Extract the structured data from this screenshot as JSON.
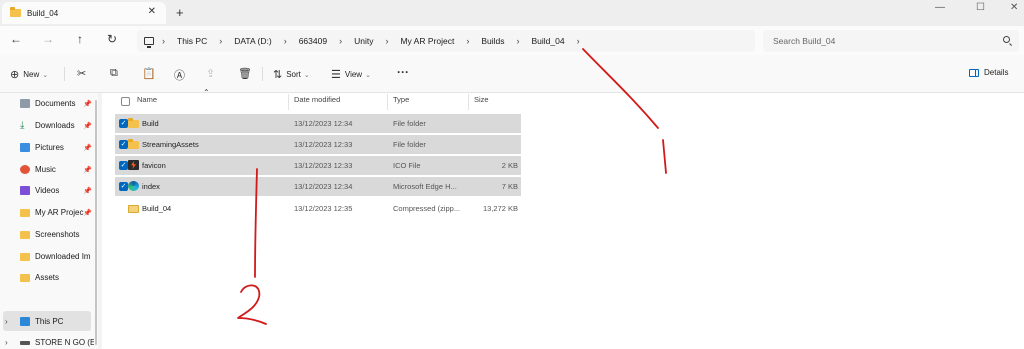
{
  "window": {
    "tab_title": "Build_04",
    "tab_close": "✕",
    "new_tab": "+",
    "controls": {
      "minimize": "—",
      "maximize": "☐",
      "close": "✕"
    }
  },
  "nav": {
    "back": "←",
    "forward": "→",
    "up": "↑",
    "refresh": "↻",
    "breadcrumbs": [
      "This PC",
      "DATA (D:)",
      "663409",
      "Unity",
      "My AR Project",
      "Builds",
      "Build_04"
    ],
    "breadcrumb_separator": "›",
    "search_placeholder": "Search Build_04"
  },
  "toolbar": {
    "new_label": "New",
    "sort_label": "Sort",
    "view_label": "View",
    "more_label": "···",
    "details_label": "Details"
  },
  "sidebar": {
    "items": [
      {
        "label": "Documents",
        "icon": "documents-icon",
        "pinned": true
      },
      {
        "label": "Downloads",
        "icon": "downloads-icon",
        "pinned": true
      },
      {
        "label": "Pictures",
        "icon": "pictures-icon",
        "pinned": true
      },
      {
        "label": "Music",
        "icon": "music-icon",
        "pinned": true
      },
      {
        "label": "Videos",
        "icon": "videos-icon",
        "pinned": true
      },
      {
        "label": "My AR Projec",
        "icon": "folder-icon",
        "pinned": true
      },
      {
        "label": "Screenshots",
        "icon": "folder-icon",
        "pinned": false
      },
      {
        "label": "Downloaded Im",
        "icon": "folder-icon",
        "pinned": false
      },
      {
        "label": "Assets",
        "icon": "folder-icon",
        "pinned": false
      },
      {
        "label": "This PC",
        "icon": "this-pc-icon",
        "pinned": false,
        "selected": true
      },
      {
        "label": "STORE N GO (E:)",
        "icon": "drive-icon",
        "pinned": false
      }
    ],
    "pin_glyph": "📌",
    "expander_glyph": "›"
  },
  "columns": {
    "name": "Name",
    "date": "Date modified",
    "type": "Type",
    "size": "Size"
  },
  "files": [
    {
      "name": "Build",
      "date": "13/12/2023 12:34",
      "type": "File folder",
      "size": "",
      "icon": "folder-icon",
      "selected": true
    },
    {
      "name": "StreamingAssets",
      "date": "13/12/2023 12:33",
      "type": "File folder",
      "size": "",
      "icon": "folder-icon",
      "selected": true
    },
    {
      "name": "favicon",
      "date": "13/12/2023 12:33",
      "type": "ICO File",
      "size": "2 KB",
      "icon": "ico-file-icon",
      "selected": true
    },
    {
      "name": "index",
      "date": "13/12/2023 12:34",
      "type": "Microsoft Edge H...",
      "size": "7 KB",
      "icon": "edge-html-icon",
      "selected": true
    },
    {
      "name": "Build_04",
      "date": "13/12/2023 12:35",
      "type": "Compressed (zipp...",
      "size": "13,272 KB",
      "icon": "zip-folder-icon",
      "selected": false
    }
  ],
  "colors": {
    "accent": "#0067c0",
    "selection": "#d9d9d9",
    "annotation": "#d11a1a"
  }
}
